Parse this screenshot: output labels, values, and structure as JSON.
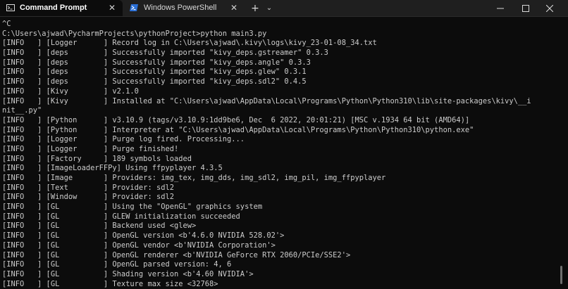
{
  "tabs": [
    {
      "label": "Command Prompt",
      "icon": "cmd-icon",
      "active": true
    },
    {
      "label": "Windows PowerShell",
      "icon": "powershell-icon",
      "active": false
    }
  ],
  "titlebar": {
    "close_tab_glyph": "✕",
    "new_tab_glyph": "+",
    "dropdown_glyph": "⌄",
    "minimize_icon": "minimize-icon",
    "maximize_icon": "maximize-icon",
    "close_icon": "close-icon"
  },
  "terminal": {
    "lines": [
      "^C",
      "C:\\Users\\ajwad\\PycharmProjects\\pythonProject>python main3.py",
      "[INFO   ] [Logger      ] Record log in C:\\Users\\ajwad\\.kivy\\logs\\kivy_23-01-08_34.txt",
      "[INFO   ] [deps        ] Successfully imported \"kivy_deps.gstreamer\" 0.3.3",
      "[INFO   ] [deps        ] Successfully imported \"kivy_deps.angle\" 0.3.3",
      "[INFO   ] [deps        ] Successfully imported \"kivy_deps.glew\" 0.3.1",
      "[INFO   ] [deps        ] Successfully imported \"kivy_deps.sdl2\" 0.4.5",
      "[INFO   ] [Kivy        ] v2.1.0",
      "[INFO   ] [Kivy        ] Installed at \"C:\\Users\\ajwad\\AppData\\Local\\Programs\\Python\\Python310\\lib\\site-packages\\kivy\\__i",
      "nit__.py\"",
      "[INFO   ] [Python      ] v3.10.9 (tags/v3.10.9:1dd9be6, Dec  6 2022, 20:01:21) [MSC v.1934 64 bit (AMD64)]",
      "[INFO   ] [Python      ] Interpreter at \"C:\\Users\\ajwad\\AppData\\Local\\Programs\\Python\\Python310\\python.exe\"",
      "[INFO   ] [Logger      ] Purge log fired. Processing...",
      "[INFO   ] [Logger      ] Purge finished!",
      "[INFO   ] [Factory     ] 189 symbols loaded",
      "[INFO   ] [ImageLoaderFFPy] Using ffpyplayer 4.3.5",
      "[INFO   ] [Image       ] Providers: img_tex, img_dds, img_sdl2, img_pil, img_ffpyplayer",
      "[INFO   ] [Text        ] Provider: sdl2",
      "[INFO   ] [Window      ] Provider: sdl2",
      "[INFO   ] [GL          ] Using the \"OpenGL\" graphics system",
      "[INFO   ] [GL          ] GLEW initialization succeeded",
      "[INFO   ] [GL          ] Backend used <glew>",
      "[INFO   ] [GL          ] OpenGL version <b'4.6.0 NVIDIA 528.02'>",
      "[INFO   ] [GL          ] OpenGL vendor <b'NVIDIA Corporation'>",
      "[INFO   ] [GL          ] OpenGL renderer <b'NVIDIA GeForce RTX 2060/PCIe/SSE2'>",
      "[INFO   ] [GL          ] OpenGL parsed version: 4, 6",
      "[INFO   ] [GL          ] Shading version <b'4.60 NVIDIA'>",
      "[INFO   ] [GL          ] Texture max size <32768>"
    ]
  },
  "colors": {
    "terminal_bg": "#0c0c0c",
    "terminal_text": "#cccccc",
    "titlebar_bg": "#1f1f1f",
    "powershell_blue": "#2a6fd6"
  }
}
